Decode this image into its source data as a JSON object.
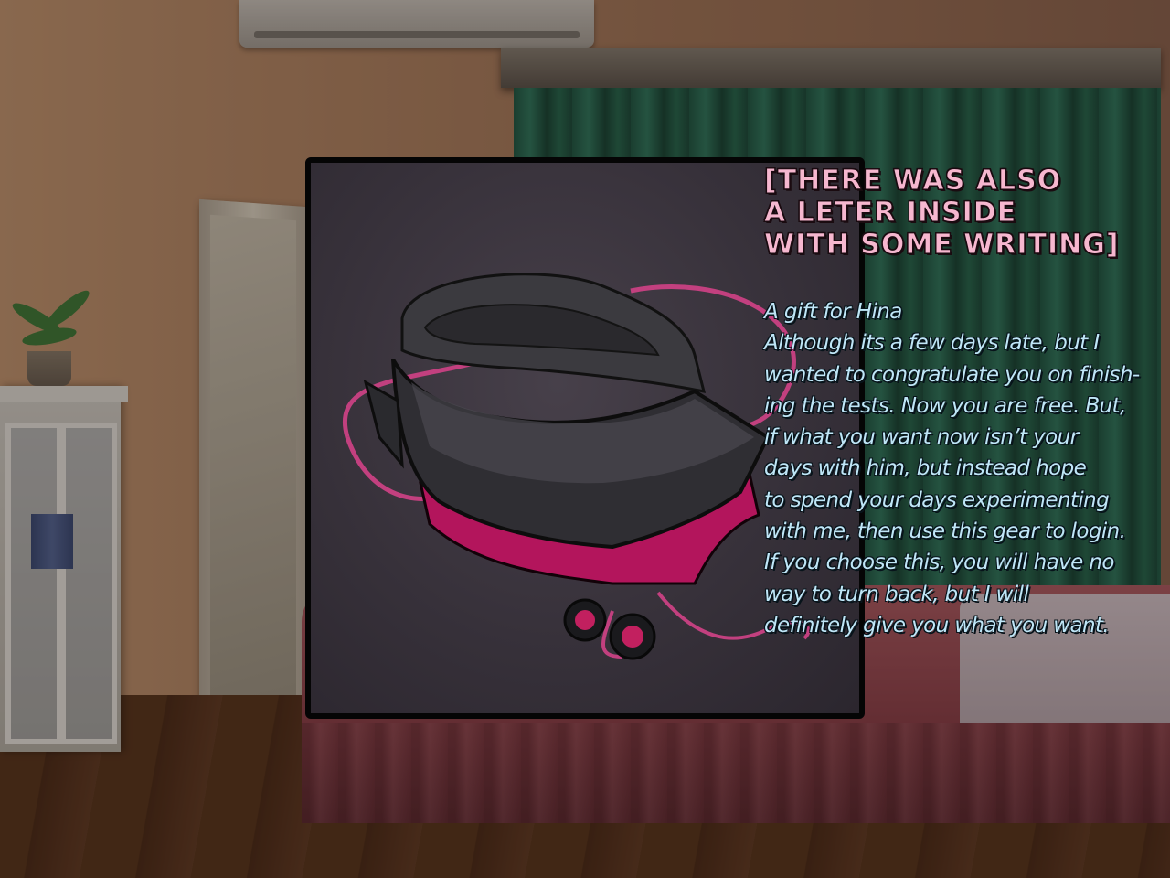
{
  "scene": {
    "location": "bedroom",
    "colors": {
      "curtain": "#2e7a5f",
      "wall": "#b88a67",
      "bed": "#b35e66",
      "floor": "#6a3f22"
    }
  },
  "item_panel": {
    "item_icon": "vr-headset-gear-icon",
    "colors": {
      "body": "#2c2b2e",
      "accent": "#b3155c",
      "cable": "#c2407f",
      "background": "#3a343d"
    }
  },
  "message": {
    "header_lines": [
      "[There was also",
      "a leter inside",
      "with some writing]"
    ],
    "letter_lines": [
      "A gift for Hina",
      "Although its a few days late, but I",
      "wanted to congratulate you on finish-",
      "ing the tests. Now you are free. But,",
      "if what you want now isn’t your",
      "days with him, but instead hope",
      "to spend your days experimenting",
      "with me, then use this gear to login.",
      "If you choose this, you will have no",
      "way to turn back, but I will",
      "definitely give you what you want."
    ],
    "colors": {
      "header": "#f6b7cf",
      "letter": "#bfe6f7",
      "outline": "#0b0b0b"
    }
  }
}
